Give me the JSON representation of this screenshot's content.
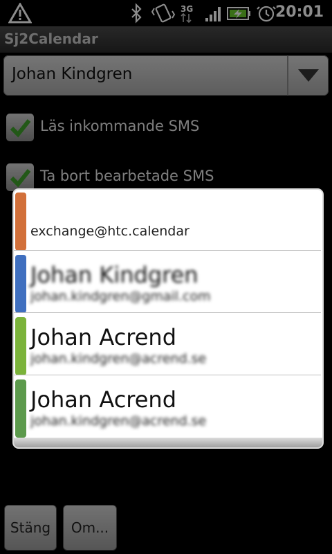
{
  "statusbar": {
    "time": "20:01",
    "network": "3G",
    "icons": [
      "warning-icon",
      "bluetooth-icon",
      "vibrate-icon",
      "network-3g-icon",
      "signal-icon",
      "battery-charging-icon",
      "alarm-icon"
    ]
  },
  "app": {
    "title": "Sj2Calendar"
  },
  "spinner": {
    "selected": "Johan Kindgren"
  },
  "checkboxes": [
    {
      "label": "Läs inkommande SMS",
      "checked": true
    },
    {
      "label": "Ta bort bearbetade SMS",
      "checked": true
    }
  ],
  "dialog": {
    "items": [
      {
        "name": "",
        "email": "exchange@htc.calendar",
        "color": "#d2703a"
      },
      {
        "name": "Johan Kindgren",
        "email": "johan.kindgren@gmail.com",
        "color": "#3f6fbf"
      },
      {
        "name": "Johan Acrend",
        "email": "johan.kindgren@acrend.se",
        "color": "#7bb33a"
      },
      {
        "name": "Johan Acrend",
        "email": "johan.kindgren@acrend.se",
        "color": "#5c9a4c"
      }
    ]
  },
  "buttons": {
    "close": "Stäng",
    "about": "Om..."
  }
}
